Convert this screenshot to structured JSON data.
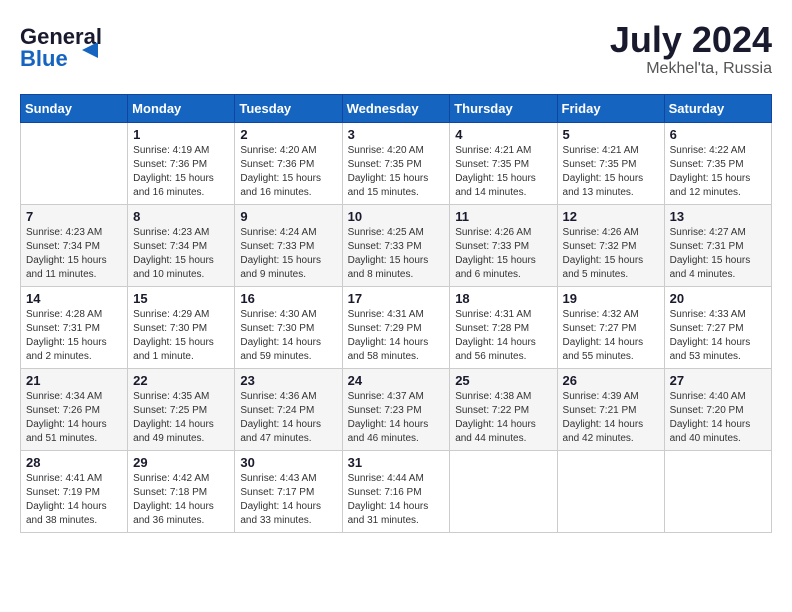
{
  "logo": {
    "line1": "General",
    "line2": "Blue"
  },
  "header": {
    "month_year": "July 2024",
    "location": "Mekhel'ta, Russia"
  },
  "days_of_week": [
    "Sunday",
    "Monday",
    "Tuesday",
    "Wednesday",
    "Thursday",
    "Friday",
    "Saturday"
  ],
  "weeks": [
    [
      {
        "day": "",
        "info": ""
      },
      {
        "day": "1",
        "info": "Sunrise: 4:19 AM\nSunset: 7:36 PM\nDaylight: 15 hours\nand 16 minutes."
      },
      {
        "day": "2",
        "info": "Sunrise: 4:20 AM\nSunset: 7:36 PM\nDaylight: 15 hours\nand 16 minutes."
      },
      {
        "day": "3",
        "info": "Sunrise: 4:20 AM\nSunset: 7:35 PM\nDaylight: 15 hours\nand 15 minutes."
      },
      {
        "day": "4",
        "info": "Sunrise: 4:21 AM\nSunset: 7:35 PM\nDaylight: 15 hours\nand 14 minutes."
      },
      {
        "day": "5",
        "info": "Sunrise: 4:21 AM\nSunset: 7:35 PM\nDaylight: 15 hours\nand 13 minutes."
      },
      {
        "day": "6",
        "info": "Sunrise: 4:22 AM\nSunset: 7:35 PM\nDaylight: 15 hours\nand 12 minutes."
      }
    ],
    [
      {
        "day": "7",
        "info": "Sunrise: 4:23 AM\nSunset: 7:34 PM\nDaylight: 15 hours\nand 11 minutes."
      },
      {
        "day": "8",
        "info": "Sunrise: 4:23 AM\nSunset: 7:34 PM\nDaylight: 15 hours\nand 10 minutes."
      },
      {
        "day": "9",
        "info": "Sunrise: 4:24 AM\nSunset: 7:33 PM\nDaylight: 15 hours\nand 9 minutes."
      },
      {
        "day": "10",
        "info": "Sunrise: 4:25 AM\nSunset: 7:33 PM\nDaylight: 15 hours\nand 8 minutes."
      },
      {
        "day": "11",
        "info": "Sunrise: 4:26 AM\nSunset: 7:33 PM\nDaylight: 15 hours\nand 6 minutes."
      },
      {
        "day": "12",
        "info": "Sunrise: 4:26 AM\nSunset: 7:32 PM\nDaylight: 15 hours\nand 5 minutes."
      },
      {
        "day": "13",
        "info": "Sunrise: 4:27 AM\nSunset: 7:31 PM\nDaylight: 15 hours\nand 4 minutes."
      }
    ],
    [
      {
        "day": "14",
        "info": "Sunrise: 4:28 AM\nSunset: 7:31 PM\nDaylight: 15 hours\nand 2 minutes."
      },
      {
        "day": "15",
        "info": "Sunrise: 4:29 AM\nSunset: 7:30 PM\nDaylight: 15 hours\nand 1 minute."
      },
      {
        "day": "16",
        "info": "Sunrise: 4:30 AM\nSunset: 7:30 PM\nDaylight: 14 hours\nand 59 minutes."
      },
      {
        "day": "17",
        "info": "Sunrise: 4:31 AM\nSunset: 7:29 PM\nDaylight: 14 hours\nand 58 minutes."
      },
      {
        "day": "18",
        "info": "Sunrise: 4:31 AM\nSunset: 7:28 PM\nDaylight: 14 hours\nand 56 minutes."
      },
      {
        "day": "19",
        "info": "Sunrise: 4:32 AM\nSunset: 7:27 PM\nDaylight: 14 hours\nand 55 minutes."
      },
      {
        "day": "20",
        "info": "Sunrise: 4:33 AM\nSunset: 7:27 PM\nDaylight: 14 hours\nand 53 minutes."
      }
    ],
    [
      {
        "day": "21",
        "info": "Sunrise: 4:34 AM\nSunset: 7:26 PM\nDaylight: 14 hours\nand 51 minutes."
      },
      {
        "day": "22",
        "info": "Sunrise: 4:35 AM\nSunset: 7:25 PM\nDaylight: 14 hours\nand 49 minutes."
      },
      {
        "day": "23",
        "info": "Sunrise: 4:36 AM\nSunset: 7:24 PM\nDaylight: 14 hours\nand 47 minutes."
      },
      {
        "day": "24",
        "info": "Sunrise: 4:37 AM\nSunset: 7:23 PM\nDaylight: 14 hours\nand 46 minutes."
      },
      {
        "day": "25",
        "info": "Sunrise: 4:38 AM\nSunset: 7:22 PM\nDaylight: 14 hours\nand 44 minutes."
      },
      {
        "day": "26",
        "info": "Sunrise: 4:39 AM\nSunset: 7:21 PM\nDaylight: 14 hours\nand 42 minutes."
      },
      {
        "day": "27",
        "info": "Sunrise: 4:40 AM\nSunset: 7:20 PM\nDaylight: 14 hours\nand 40 minutes."
      }
    ],
    [
      {
        "day": "28",
        "info": "Sunrise: 4:41 AM\nSunset: 7:19 PM\nDaylight: 14 hours\nand 38 minutes."
      },
      {
        "day": "29",
        "info": "Sunrise: 4:42 AM\nSunset: 7:18 PM\nDaylight: 14 hours\nand 36 minutes."
      },
      {
        "day": "30",
        "info": "Sunrise: 4:43 AM\nSunset: 7:17 PM\nDaylight: 14 hours\nand 33 minutes."
      },
      {
        "day": "31",
        "info": "Sunrise: 4:44 AM\nSunset: 7:16 PM\nDaylight: 14 hours\nand 31 minutes."
      },
      {
        "day": "",
        "info": ""
      },
      {
        "day": "",
        "info": ""
      },
      {
        "day": "",
        "info": ""
      }
    ]
  ]
}
